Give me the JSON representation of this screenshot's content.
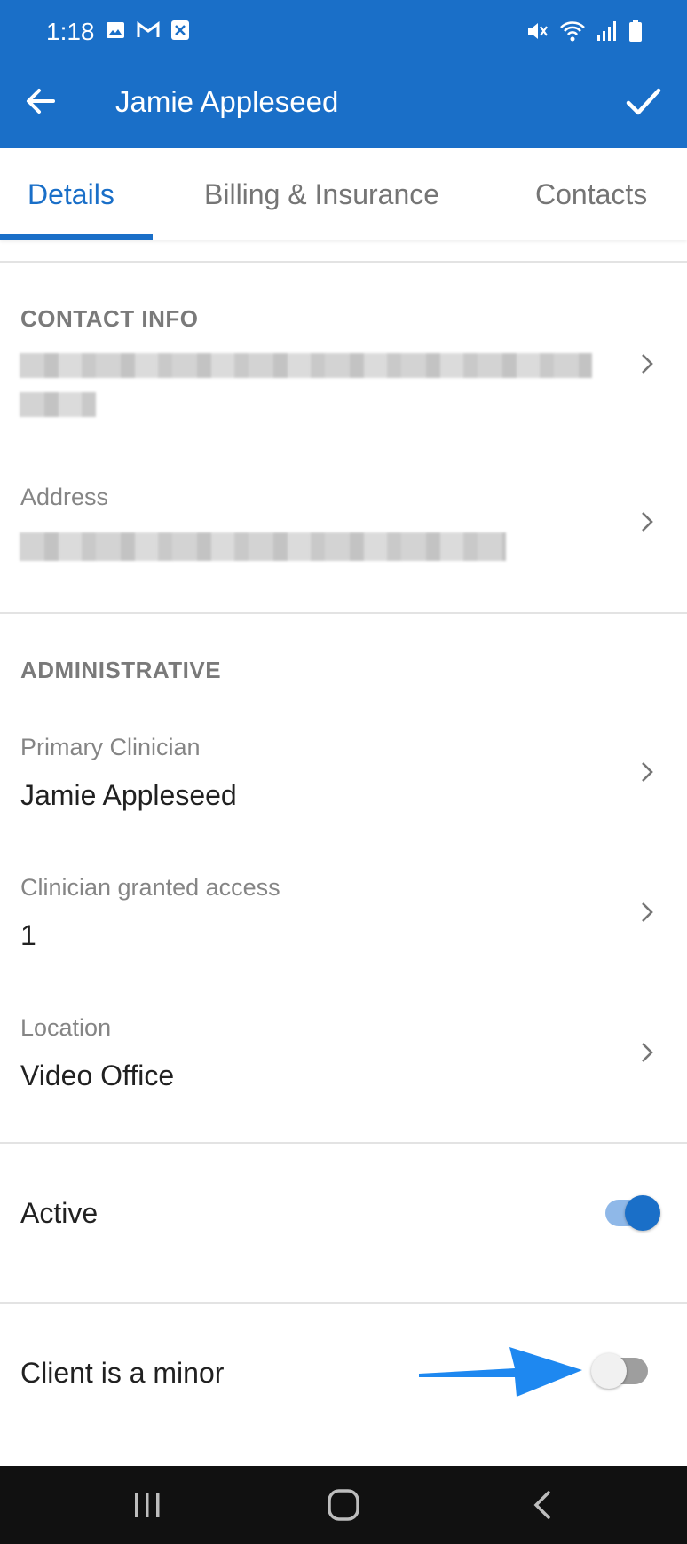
{
  "status_bar": {
    "time": "1:18",
    "left_icons": [
      "image-icon",
      "gmail-icon",
      "close-box-icon"
    ],
    "right_icons": [
      "mute-icon",
      "wifi-icon",
      "signal-icon",
      "battery-icon"
    ]
  },
  "app_bar": {
    "title": "Jamie Appleseed",
    "back_icon": "arrow-back-icon",
    "confirm_icon": "check-icon",
    "color": "#1a6fc8"
  },
  "tabs": [
    {
      "label": "Details",
      "active": true
    },
    {
      "label": "Billing & Insurance",
      "active": false
    },
    {
      "label": "Contacts",
      "active": false
    }
  ],
  "contact_info": {
    "header": "CONTACT INFO",
    "address_label": "Address"
  },
  "administrative": {
    "header": "ADMINISTRATIVE",
    "primary_clinician_label": "Primary Clinician",
    "primary_clinician_value": "Jamie Appleseed",
    "clinician_access_label": "Clinician granted access",
    "clinician_access_value": "1",
    "location_label": "Location",
    "location_value": "Video Office"
  },
  "toggles": {
    "active_label": "Active",
    "active_on": true,
    "minor_label": "Client is a minor",
    "minor_on": false
  },
  "nav_bar": {
    "icons": [
      "recents-icon",
      "home-icon",
      "back-icon"
    ]
  }
}
